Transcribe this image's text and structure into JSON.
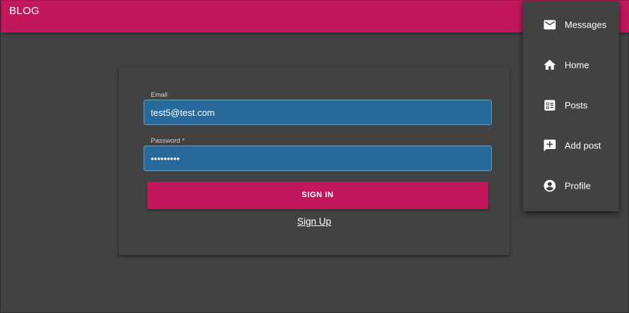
{
  "appbar": {
    "title": "BLOG",
    "color": "#c2185b"
  },
  "login_form": {
    "email": {
      "label": "Email",
      "value": "test5@test.com"
    },
    "password": {
      "label": "Password *",
      "value": "•••••••••"
    },
    "signin_label": "SIGN IN",
    "signup_label": "Sign Up"
  },
  "menu": {
    "items": [
      {
        "label": "Messages",
        "icon": "mail-icon"
      },
      {
        "label": "Home",
        "icon": "home-icon"
      },
      {
        "label": "Posts",
        "icon": "posts-icon"
      },
      {
        "label": "Add post",
        "icon": "add-post-icon"
      },
      {
        "label": "Profile",
        "icon": "profile-icon"
      }
    ]
  },
  "colors": {
    "background": "#424242",
    "input_fill": "#27699a",
    "accent": "#c2185b"
  }
}
